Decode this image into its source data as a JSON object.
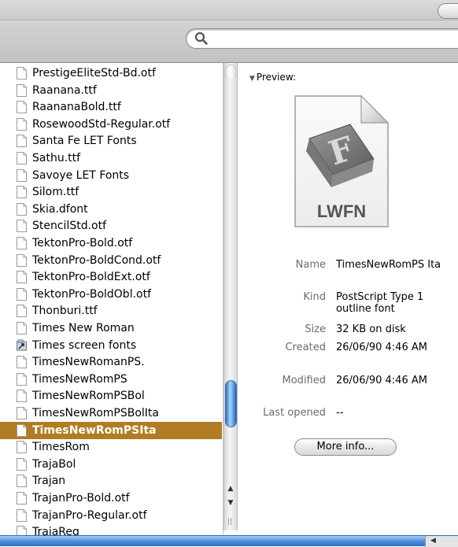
{
  "file_list": {
    "items": [
      {
        "label": "PrestigeEliteStd-Bd.otf",
        "icon": "document-icon"
      },
      {
        "label": "Raanana.ttf",
        "icon": "document-icon"
      },
      {
        "label": "RaananaBold.ttf",
        "icon": "document-icon"
      },
      {
        "label": "RosewoodStd-Regular.otf",
        "icon": "document-icon"
      },
      {
        "label": "Santa Fe LET Fonts",
        "icon": "document-icon"
      },
      {
        "label": "Sathu.ttf",
        "icon": "document-icon"
      },
      {
        "label": "Savoye LET Fonts",
        "icon": "document-icon"
      },
      {
        "label": "Silom.ttf",
        "icon": "document-icon"
      },
      {
        "label": "Skia.dfont",
        "icon": "document-icon"
      },
      {
        "label": "StencilStd.otf",
        "icon": "document-icon"
      },
      {
        "label": "TektonPro-Bold.otf",
        "icon": "document-icon"
      },
      {
        "label": "TektonPro-BoldCond.otf",
        "icon": "document-icon"
      },
      {
        "label": "TektonPro-BoldExt.otf",
        "icon": "document-icon"
      },
      {
        "label": "TektonPro-BoldObl.otf",
        "icon": "document-icon"
      },
      {
        "label": "Thonburi.ttf",
        "icon": "document-icon"
      },
      {
        "label": "Times New Roman",
        "icon": "document-icon"
      },
      {
        "label": "Times screen fonts",
        "icon": "alias-icon"
      },
      {
        "label": "TimesNewRomanPS.",
        "icon": "document-icon"
      },
      {
        "label": "TimesNewRomPS",
        "icon": "document-icon"
      },
      {
        "label": "TimesNewRomPSBol",
        "icon": "document-icon"
      },
      {
        "label": "TimesNewRomPSBolIta",
        "icon": "document-icon"
      },
      {
        "label": "TimesNewRomPSIta",
        "icon": "document-icon",
        "selected": true
      },
      {
        "label": "TimesRom",
        "icon": "document-icon"
      },
      {
        "label": "TrajaBol",
        "icon": "document-icon"
      },
      {
        "label": "Trajan",
        "icon": "document-icon"
      },
      {
        "label": "TrajanPro-Bold.otf",
        "icon": "document-icon"
      },
      {
        "label": "TrajanPro-Regular.otf",
        "icon": "document-icon"
      },
      {
        "label": "TrajaReg",
        "icon": "document-icon"
      }
    ],
    "selection_color": "#b07d22"
  },
  "preview": {
    "header": "Preview:",
    "icon_caption": "LWFN",
    "info": {
      "name_key": "Name",
      "name_value": "TimesNewRomPS Ita",
      "kind_key": "Kind",
      "kind_value": "PostScript Type 1 outline font",
      "size_key": "Size",
      "size_value": "32 KB on disk",
      "created_key": "Created",
      "created_value": "26/06/90 4:46 AM",
      "modified_key": "Modified",
      "modified_value": "26/06/90 4:46 AM",
      "last_opened_key": "Last opened",
      "last_opened_value": "--"
    },
    "more_info_button": "More info..."
  },
  "scrollbar_accent": "#4e8fdc"
}
